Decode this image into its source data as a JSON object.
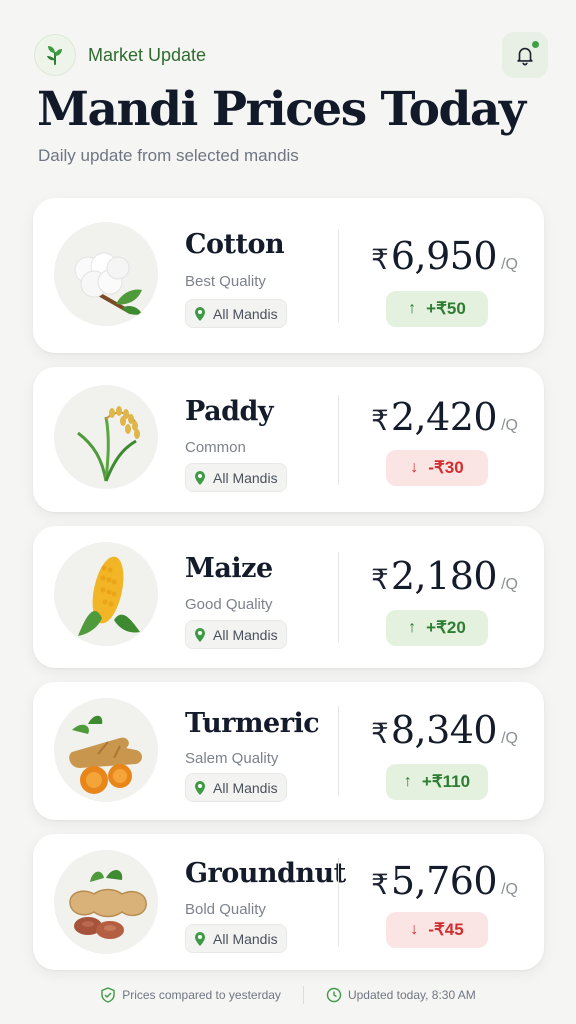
{
  "header": {
    "eyebrow": "Market Update",
    "title": "Mandi Prices Today",
    "subtitle": "Daily update from selected mandis"
  },
  "colors": {
    "brand_green": "#2f6b2f",
    "up_green": "#2e7d32",
    "down_red": "#d12f2f"
  },
  "currency_symbol": "₹",
  "unit": "/Q",
  "crops": [
    {
      "name": "Cotton",
      "grade": "Best Quality",
      "mandi": "All Mandis",
      "price": "6,950",
      "change": "+₹50",
      "direction": "up",
      "icon": "cotton-icon"
    },
    {
      "name": "Paddy",
      "grade": "Common",
      "mandi": "All Mandis",
      "price": "2,420",
      "change": "-₹30",
      "direction": "down",
      "icon": "paddy-icon"
    },
    {
      "name": "Maize",
      "grade": "Good Quality",
      "mandi": "All Mandis",
      "price": "2,180",
      "change": "+₹20",
      "direction": "up",
      "icon": "maize-icon"
    },
    {
      "name": "Turmeric",
      "grade": "Salem Quality",
      "mandi": "All Mandis",
      "price": "8,340",
      "change": "+₹110",
      "direction": "up",
      "icon": "turmeric-icon"
    },
    {
      "name": "Groundnut",
      "grade": "Bold Quality",
      "mandi": "All Mandis",
      "price": "5,760",
      "change": "-₹45",
      "direction": "down",
      "icon": "groundnut-icon"
    }
  ],
  "footer": {
    "compared": "Prices compared to yesterday",
    "updated": "Updated today, 8:30 AM"
  }
}
